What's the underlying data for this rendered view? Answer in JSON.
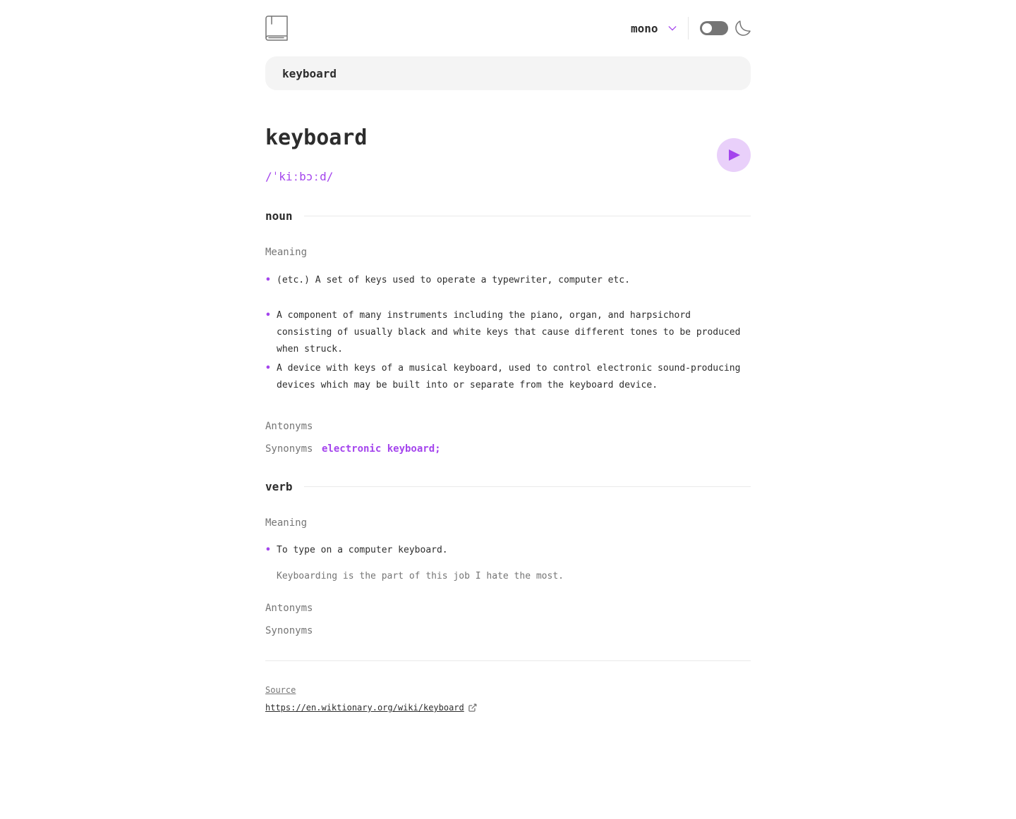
{
  "header": {
    "font_label": "mono",
    "icons": {
      "logo": "book-icon",
      "chevron": "chevron-down-icon",
      "theme": "moon-icon"
    },
    "theme_toggle_on": false
  },
  "search": {
    "value": "keyboard",
    "placeholder": ""
  },
  "entry": {
    "word": "keyboard",
    "phonetic": "/ˈkiːbɔːd/",
    "play_icon": "play-icon",
    "meanings": [
      {
        "part_of_speech": "noun",
        "meaning_label": "Meaning",
        "definitions": [
          {
            "text": "(etc.) A set of keys used to operate a typewriter, computer etc."
          },
          {
            "text": "A component of many instruments including the piano, organ, and harpsichord consisting of usually black and white keys that cause different tones to be produced when struck."
          },
          {
            "text": "A device with keys of a musical keyboard, used to control electronic sound-producing devices which may be built into or separate from the keyboard device."
          }
        ],
        "antonyms_label": "Antonyms",
        "synonyms_label": "Synonyms",
        "synonyms": [
          "electronic keyboard;"
        ]
      },
      {
        "part_of_speech": "verb",
        "meaning_label": "Meaning",
        "definitions": [
          {
            "text": "To type on a computer keyboard.",
            "example": "Keyboarding is the part of this job I hate the most."
          }
        ],
        "antonyms_label": "Antonyms",
        "synonyms_label": "Synonyms",
        "synonyms": []
      }
    ]
  },
  "footer": {
    "source_label": "Source",
    "source_url": "https://en.wiktionary.org/wiki/keyboard",
    "link_icon": "external-link-icon"
  },
  "colors": {
    "accent": "#a445ed",
    "accent_light": "#e9d0fa",
    "text": "#2d2d2d",
    "muted": "#757575",
    "field_bg": "#f4f4f4",
    "toggle": "#757575"
  }
}
